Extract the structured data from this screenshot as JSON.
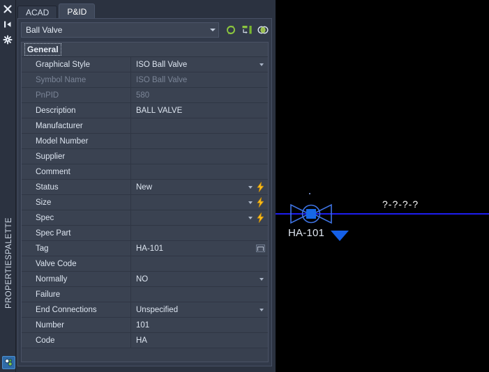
{
  "app": {
    "palette_title": "PROPERTIESPALETTE"
  },
  "left_strip": {
    "icons": [
      {
        "name": "close-icon",
        "label": "Close"
      },
      {
        "name": "auto-hide-icon",
        "label": "Auto-hide"
      },
      {
        "name": "palette-properties-icon",
        "label": "Properties"
      }
    ],
    "bottom_icon": {
      "name": "pnid-status-icon",
      "label": "P&ID"
    }
  },
  "tabs": [
    {
      "id": "acad",
      "label": "ACAD",
      "active": false
    },
    {
      "id": "pnid",
      "label": "P&ID",
      "active": true
    }
  ],
  "selector": {
    "value": "Ball Valve",
    "icons": [
      {
        "name": "refresh-icon",
        "label": "Refresh"
      },
      {
        "name": "quick-select-icon",
        "label": "Quick Select"
      },
      {
        "name": "select-objects-icon",
        "label": "Select Objects"
      }
    ]
  },
  "grid": {
    "category": "General",
    "rows": [
      {
        "label": "Graphical Style",
        "value": "ISO Ball Valve",
        "dropdown": true,
        "bolt": false,
        "button": false,
        "disabled": false
      },
      {
        "label": "Symbol Name",
        "value": "ISO Ball Valve",
        "dropdown": false,
        "bolt": false,
        "button": false,
        "disabled": true
      },
      {
        "label": "PnPID",
        "value": "580",
        "dropdown": false,
        "bolt": false,
        "button": false,
        "disabled": true
      },
      {
        "label": "Description",
        "value": "BALL VALVE",
        "dropdown": false,
        "bolt": false,
        "button": false,
        "disabled": false
      },
      {
        "label": "Manufacturer",
        "value": "",
        "dropdown": false,
        "bolt": false,
        "button": false,
        "disabled": false
      },
      {
        "label": "Model Number",
        "value": "",
        "dropdown": false,
        "bolt": false,
        "button": false,
        "disabled": false
      },
      {
        "label": "Supplier",
        "value": "",
        "dropdown": false,
        "bolt": false,
        "button": false,
        "disabled": false
      },
      {
        "label": "Comment",
        "value": "",
        "dropdown": false,
        "bolt": false,
        "button": false,
        "disabled": false
      },
      {
        "label": "Status",
        "value": "New",
        "dropdown": true,
        "bolt": true,
        "button": false,
        "disabled": false
      },
      {
        "label": "Size",
        "value": "",
        "dropdown": true,
        "bolt": true,
        "button": false,
        "disabled": false
      },
      {
        "label": "Spec",
        "value": "",
        "dropdown": true,
        "bolt": true,
        "button": false,
        "disabled": false
      },
      {
        "label": "Spec Part",
        "value": "",
        "dropdown": false,
        "bolt": false,
        "button": false,
        "disabled": false
      },
      {
        "label": "Tag",
        "value": "HA-101",
        "dropdown": false,
        "bolt": false,
        "button": true,
        "disabled": false
      },
      {
        "label": "Valve Code",
        "value": "",
        "dropdown": false,
        "bolt": false,
        "button": false,
        "disabled": false
      },
      {
        "label": "Normally",
        "value": "NO",
        "dropdown": true,
        "bolt": false,
        "button": false,
        "disabled": false
      },
      {
        "label": "Failure",
        "value": "",
        "dropdown": false,
        "bolt": false,
        "button": false,
        "disabled": false
      },
      {
        "label": "End Connections",
        "value": "Unspecified",
        "dropdown": true,
        "bolt": false,
        "button": false,
        "disabled": false
      },
      {
        "label": "Number",
        "value": "101",
        "dropdown": false,
        "bolt": false,
        "button": false,
        "disabled": false
      },
      {
        "label": "Code",
        "value": "HA",
        "dropdown": false,
        "bolt": false,
        "button": false,
        "disabled": false
      }
    ]
  },
  "canvas": {
    "valve_tag": "HA-101",
    "pipe_annotation": "?-?-?-?",
    "colors": {
      "pipe": "#1d1df0",
      "symbol": "#3a6fe0",
      "grip": "#1560e8",
      "background": "#000000"
    }
  }
}
